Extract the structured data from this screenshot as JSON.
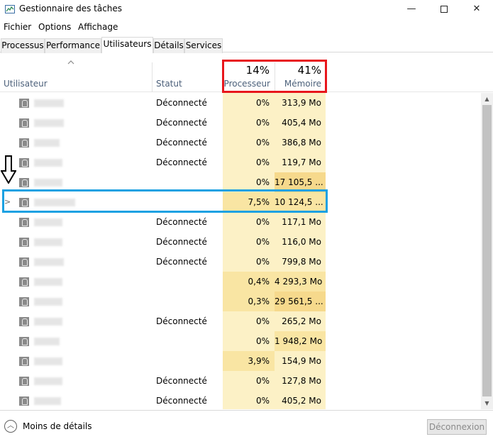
{
  "window": {
    "title": "Gestionnaire des tâches",
    "min_symbol": "—",
    "close_symbol": "✕"
  },
  "menu": [
    "Fichier",
    "Options",
    "Affichage"
  ],
  "tabs": [
    {
      "label": "Processus",
      "active": false
    },
    {
      "label": "Performance",
      "active": false
    },
    {
      "label": "Utilisateurs",
      "active": true
    },
    {
      "label": "Détails",
      "active": false
    },
    {
      "label": "Services",
      "active": false
    }
  ],
  "columns": {
    "user": "Utilisateur",
    "status": "Statut",
    "cpu_label": "Processeur",
    "cpu_percent": "14%",
    "mem_label": "Mémoire",
    "mem_percent": "41%"
  },
  "rows": [
    {
      "status": "Déconnecté",
      "cpu": "0%",
      "mem": "313,9 Mo",
      "mem_heat": "none",
      "cpu_heat": "none",
      "expand": ""
    },
    {
      "status": "Déconnecté",
      "cpu": "0%",
      "mem": "405,4 Mo",
      "mem_heat": "none",
      "cpu_heat": "none",
      "expand": ""
    },
    {
      "status": "Déconnecté",
      "cpu": "0%",
      "mem": "386,8 Mo",
      "mem_heat": "none",
      "cpu_heat": "none",
      "expand": ""
    },
    {
      "status": "Déconnecté",
      "cpu": "0%",
      "mem": "119,7 Mo",
      "mem_heat": "none",
      "cpu_heat": "none",
      "expand": ""
    },
    {
      "status": "",
      "cpu": "0%",
      "mem": "17 105,5 ...",
      "mem_heat": "hot",
      "cpu_heat": "none",
      "expand": ""
    },
    {
      "status": "",
      "cpu": "7,5%",
      "mem": "10 124,5 ...",
      "mem_heat": "warm",
      "cpu_heat": "warm",
      "expand": ">"
    },
    {
      "status": "Déconnecté",
      "cpu": "0%",
      "mem": "117,1 Mo",
      "mem_heat": "none",
      "cpu_heat": "none",
      "expand": ""
    },
    {
      "status": "Déconnecté",
      "cpu": "0%",
      "mem": "116,0 Mo",
      "mem_heat": "none",
      "cpu_heat": "none",
      "expand": ""
    },
    {
      "status": "Déconnecté",
      "cpu": "0%",
      "mem": "799,8 Mo",
      "mem_heat": "none",
      "cpu_heat": "none",
      "expand": ""
    },
    {
      "status": "",
      "cpu": "0,4%",
      "mem": "4 293,3 Mo",
      "mem_heat": "warm",
      "cpu_heat": "warm",
      "expand": ""
    },
    {
      "status": "",
      "cpu": "0,3%",
      "mem": "29 561,5 ...",
      "mem_heat": "hot",
      "cpu_heat": "warm",
      "expand": ""
    },
    {
      "status": "Déconnecté",
      "cpu": "0%",
      "mem": "265,2 Mo",
      "mem_heat": "none",
      "cpu_heat": "none",
      "expand": ""
    },
    {
      "status": "",
      "cpu": "0%",
      "mem": "1 948,2 Mo",
      "mem_heat": "warm",
      "cpu_heat": "none",
      "expand": ""
    },
    {
      "status": "",
      "cpu": "3,9%",
      "mem": "154,9 Mo",
      "mem_heat": "none",
      "cpu_heat": "warm",
      "expand": ""
    },
    {
      "status": "Déconnecté",
      "cpu": "0%",
      "mem": "127,8 Mo",
      "mem_heat": "none",
      "cpu_heat": "none",
      "expand": ""
    },
    {
      "status": "Déconnecté",
      "cpu": "0%",
      "mem": "405,2 Mo",
      "mem_heat": "none",
      "cpu_heat": "none",
      "expand": ""
    }
  ],
  "footer": {
    "less_details": "Moins de détails",
    "disconnect": "Déconnexion"
  },
  "colors": {
    "highlight_red": "#e8161c",
    "highlight_blue": "#1ba1e2",
    "heat_base": "#fcf1c6"
  }
}
